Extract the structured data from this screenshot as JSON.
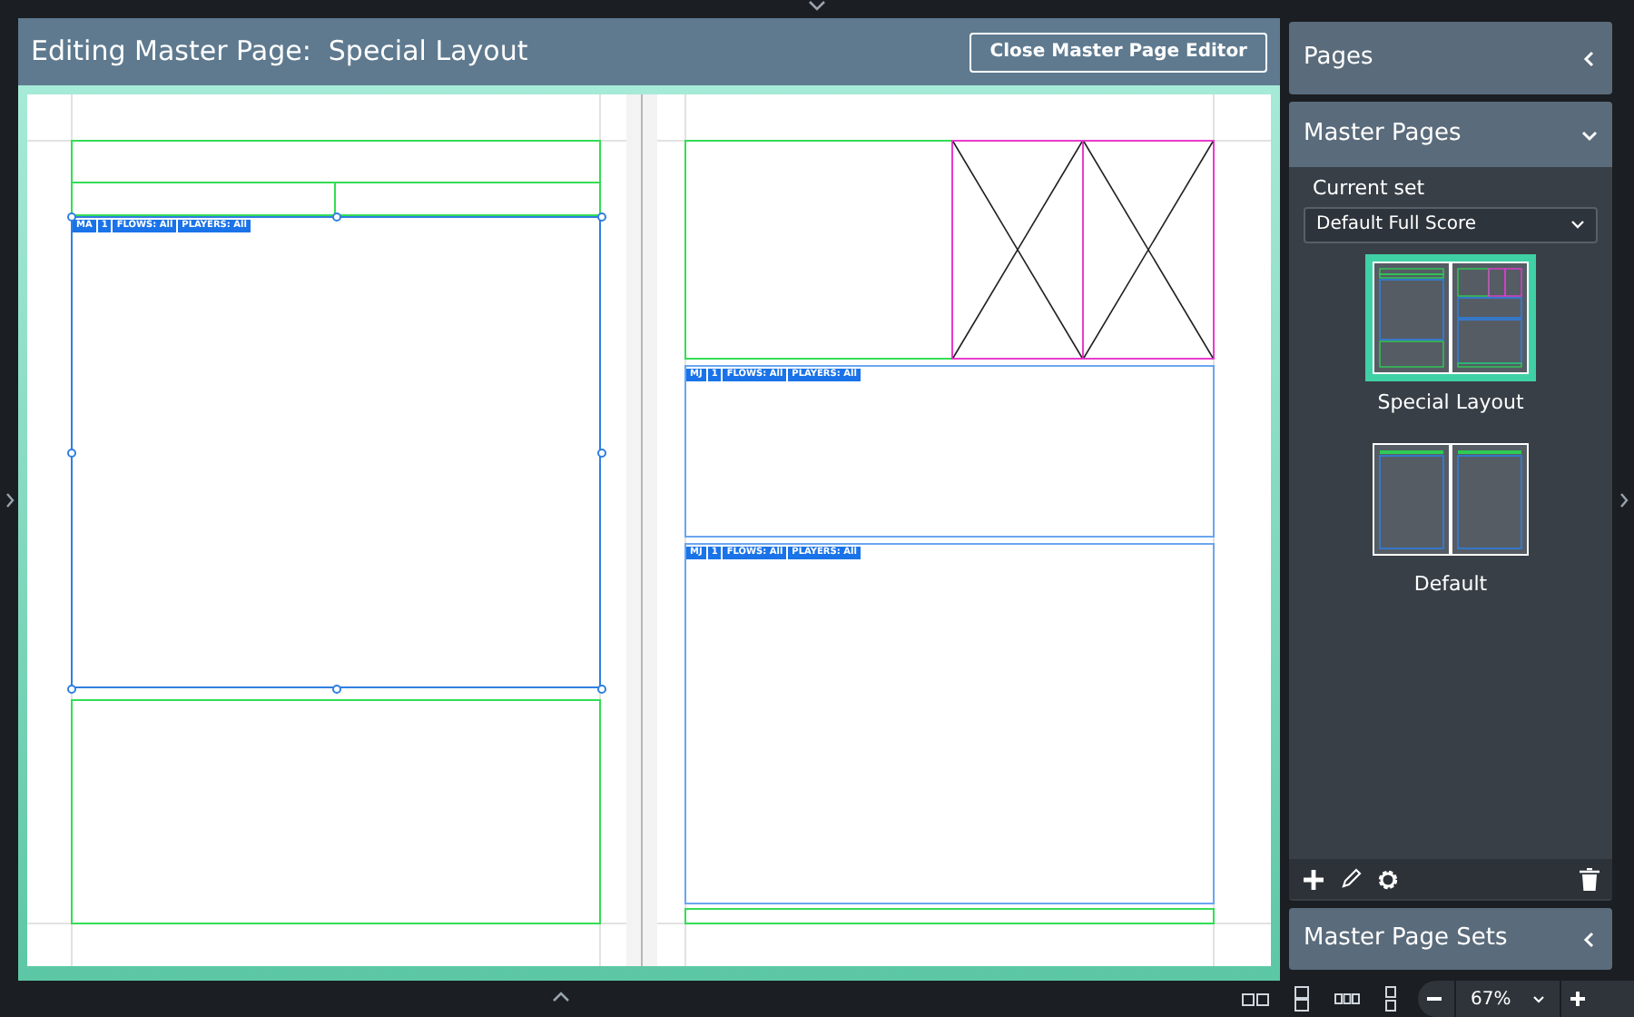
{
  "editor": {
    "title": "Editing Master Page:  Special Layout",
    "close_button": "Close Master Page Editor"
  },
  "frames": [
    {
      "kind": "music",
      "selected": true,
      "tags": [
        "MA",
        "1",
        "FLOWS: All",
        "PLAYERS: All"
      ]
    },
    {
      "kind": "music",
      "selected": false,
      "tags": [
        "MJ",
        "1",
        "FLOWS: All",
        "PLAYERS: All"
      ]
    },
    {
      "kind": "music",
      "selected": false,
      "tags": [
        "MJ",
        "1",
        "FLOWS: All",
        "PLAYERS: All"
      ]
    }
  ],
  "panels": {
    "pages": {
      "title": "Pages",
      "expanded": false
    },
    "master_pages": {
      "title": "Master Pages",
      "expanded": true,
      "current_set_label": "Current set",
      "current_set": "Default Full Score",
      "items": [
        {
          "name": "Special Layout",
          "selected": true,
          "kind": "special"
        },
        {
          "name": "Default",
          "selected": false,
          "kind": "default"
        }
      ]
    },
    "master_page_sets": {
      "title": "Master Page Sets",
      "expanded": false
    }
  },
  "status_bar": {
    "zoom": "67%"
  }
}
